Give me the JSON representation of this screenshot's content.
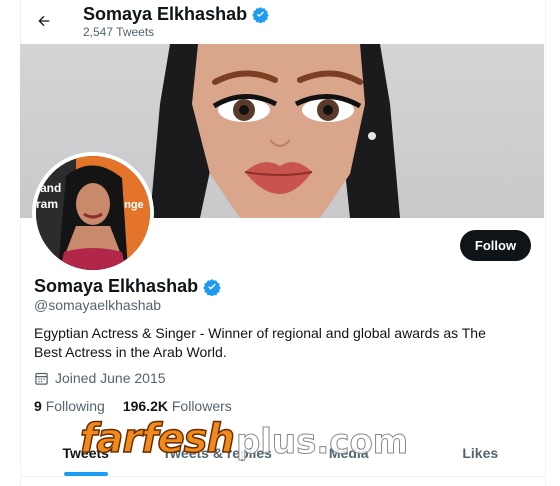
{
  "header": {
    "name": "Somaya Elkhashab",
    "tweet_count": "2,547 Tweets"
  },
  "profile": {
    "display_name": "Somaya Elkhashab",
    "handle": "@somayaelkhashab",
    "bio": "Egyptian Actress & Singer - Winner of regional and global awards as The Best Actress in the Arab World.",
    "joined": "Joined June 2015",
    "following_count": "9",
    "following_label": "Following",
    "followers_count": "196.2K",
    "followers_label": "Followers"
  },
  "follow_button": "Follow",
  "tabs": [
    {
      "label": "Tweets",
      "active": true
    },
    {
      "label": "Tweets & replies",
      "active": false
    },
    {
      "label": "Media",
      "active": false
    },
    {
      "label": "Likes",
      "active": false
    }
  ],
  "avatar_overlay_text": [
    "and",
    "ram",
    "enge"
  ],
  "watermark": {
    "main": "farfesh",
    "sub": "plus.com"
  },
  "colors": {
    "verified": "#1d9bf0",
    "follow_bg": "#0f1419",
    "tab_indicator": "#1d9bf0",
    "watermark": "#f08a1c"
  }
}
